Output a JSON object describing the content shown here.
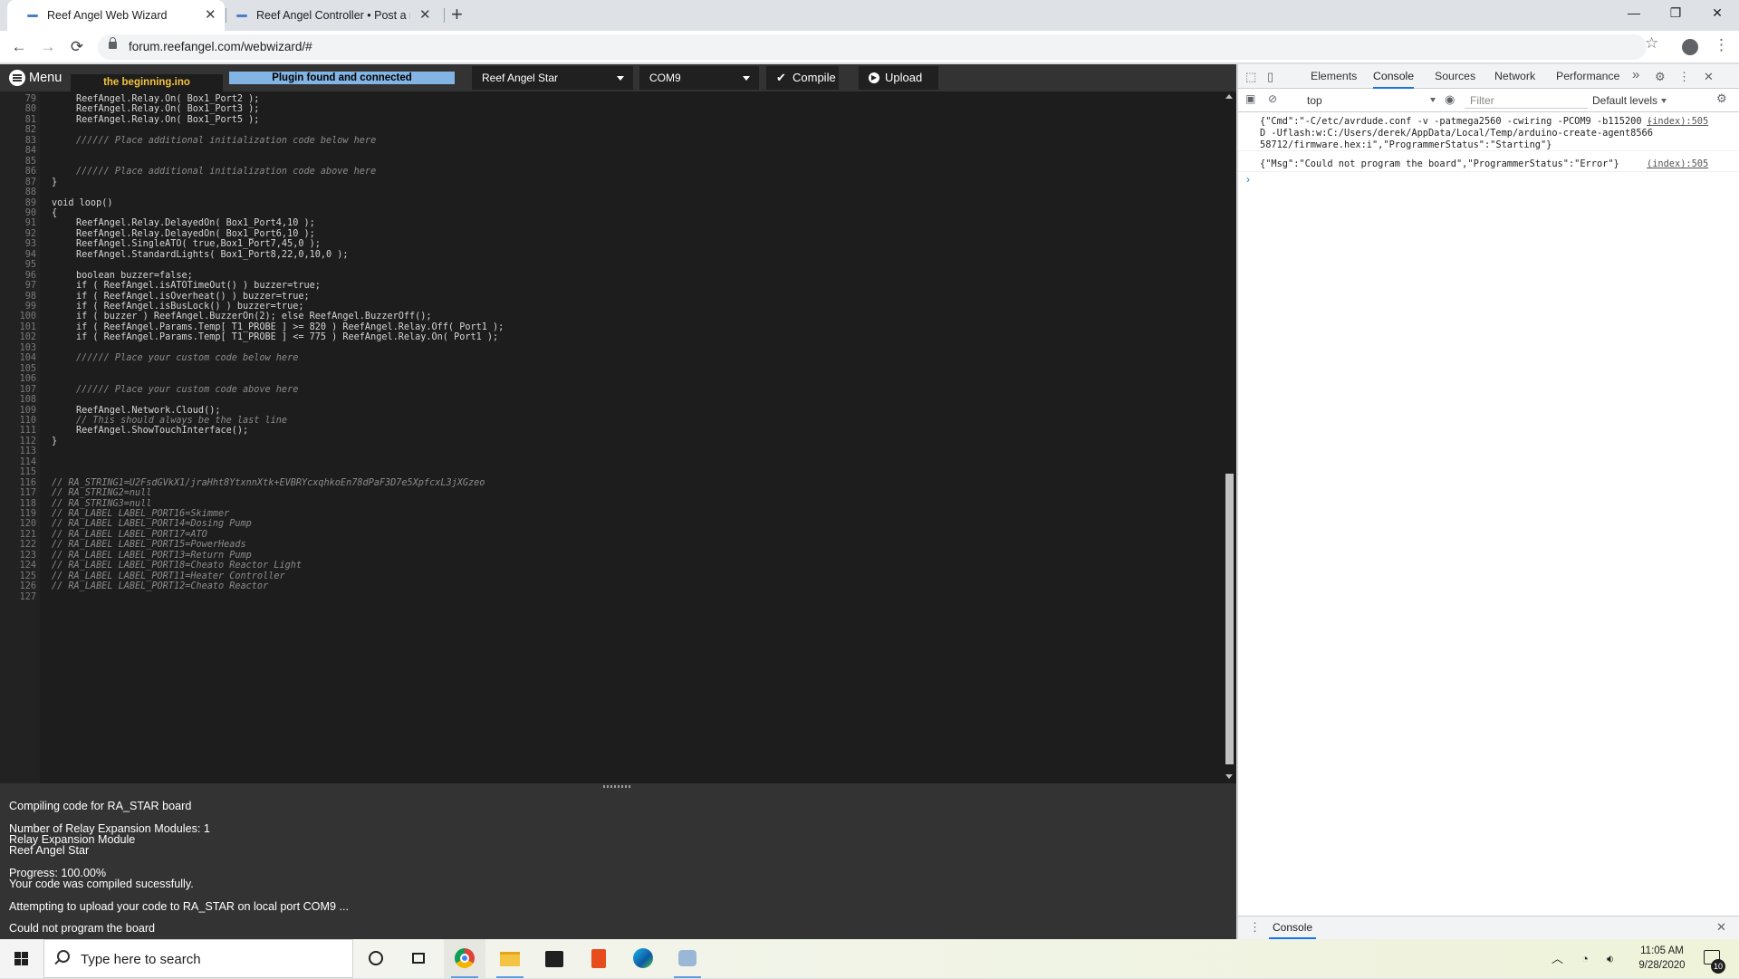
{
  "browser": {
    "tabs": [
      {
        "title": "Reef Angel Web Wizard",
        "active": true
      },
      {
        "title": "Reef Angel Controller • Post a rep",
        "active": false
      }
    ],
    "new_tab_glyph": "+",
    "close_glyph": "✕",
    "url": "forum.reefangel.com/webwizard/#",
    "window_controls": {
      "minimize": "—",
      "maximize": "❐",
      "close": "✕"
    },
    "nav": {
      "back": "←",
      "forward": "→",
      "reload": "⟳"
    },
    "icons": {
      "bookmark": "star-icon",
      "profile": "account-circle-icon",
      "menu": "kebab-menu-icon"
    }
  },
  "wizard": {
    "menu_label": "Menu",
    "file_tab": "the beginning.ino",
    "status": "Plugin found and connected",
    "board_select": "Reef Angel Star",
    "port_select": "COM9",
    "compile_label": "Compile",
    "upload_label": "Upload",
    "code_lines": [
      {
        "n": "79",
        "t": "ReefAngel.Relay.On( Box1_Port2 );",
        "c": false
      },
      {
        "n": "80",
        "t": "ReefAngel.Relay.On( Box1_Port3 );",
        "c": false
      },
      {
        "n": "81",
        "t": "ReefAngel.Relay.On( Box1_Port5 );",
        "c": false
      },
      {
        "n": "82",
        "t": "",
        "c": false
      },
      {
        "n": "83",
        "t": "////// Place additional initialization code below here",
        "c": true
      },
      {
        "n": "84",
        "t": "",
        "c": false
      },
      {
        "n": "85",
        "t": "",
        "c": false
      },
      {
        "n": "86",
        "t": "////// Place additional initialization code above here",
        "c": true
      },
      {
        "n": "87",
        "t": "}",
        "c": false
      },
      {
        "n": "88",
        "t": "",
        "c": false
      },
      {
        "n": "89",
        "t": "void loop()",
        "c": false
      },
      {
        "n": "90",
        "t": "{",
        "c": false
      },
      {
        "n": "91",
        "t": "ReefAngel.Relay.DelayedOn( Box1_Port4,10 );",
        "c": false
      },
      {
        "n": "92",
        "t": "ReefAngel.Relay.DelayedOn( Box1_Port6,10 );",
        "c": false
      },
      {
        "n": "93",
        "t": "ReefAngel.SingleATO( true,Box1_Port7,45,0 );",
        "c": false
      },
      {
        "n": "94",
        "t": "ReefAngel.StandardLights( Box1_Port8,22,0,10,0 );",
        "c": false
      },
      {
        "n": "95",
        "t": "",
        "c": false
      },
      {
        "n": "96",
        "t": "boolean buzzer=false;",
        "c": false
      },
      {
        "n": "97",
        "t": "if ( ReefAngel.isATOTimeOut() ) buzzer=true;",
        "c": false
      },
      {
        "n": "98",
        "t": "if ( ReefAngel.isOverheat() ) buzzer=true;",
        "c": false
      },
      {
        "n": "99",
        "t": "if ( ReefAngel.isBusLock() ) buzzer=true;",
        "c": false
      },
      {
        "n": "100",
        "t": "if ( buzzer ) ReefAngel.BuzzerOn(2); else ReefAngel.BuzzerOff();",
        "c": false
      },
      {
        "n": "101",
        "t": "if ( ReefAngel.Params.Temp[ T1_PROBE ] >= 820 ) ReefAngel.Relay.Off( Port1 );",
        "c": false
      },
      {
        "n": "102",
        "t": "if ( ReefAngel.Params.Temp[ T1_PROBE ] <= 775 ) ReefAngel.Relay.On( Port1 );",
        "c": false
      },
      {
        "n": "103",
        "t": "",
        "c": false
      },
      {
        "n": "104",
        "t": "////// Place your custom code below here",
        "c": true
      },
      {
        "n": "105",
        "t": "",
        "c": false
      },
      {
        "n": "106",
        "t": "",
        "c": false
      },
      {
        "n": "107",
        "t": "////// Place your custom code above here",
        "c": true
      },
      {
        "n": "108",
        "t": "",
        "c": false
      },
      {
        "n": "109",
        "t": "ReefAngel.Network.Cloud();",
        "c": false
      },
      {
        "n": "110",
        "t": "// This should always be the last line",
        "c": true
      },
      {
        "n": "111",
        "t": "ReefAngel.ShowTouchInterface();",
        "c": false
      },
      {
        "n": "112",
        "t": "}",
        "c": false
      },
      {
        "n": "113",
        "t": "",
        "c": false
      },
      {
        "n": "114",
        "t": "",
        "c": false
      },
      {
        "n": "115",
        "t": "",
        "c": false
      },
      {
        "n": "116",
        "t": "// RA_STRING1=U2FsdGVkX1/jraHht8YtxnnXtk+EVBRYcxqhkoEn78dPaF3D7e5XpfcxL3jXGzeo",
        "c": true
      },
      {
        "n": "117",
        "t": "// RA_STRING2=null",
        "c": true
      },
      {
        "n": "118",
        "t": "// RA_STRING3=null",
        "c": true
      },
      {
        "n": "119",
        "t": "// RA_LABEL LABEL_PORT16=Skimmer",
        "c": true
      },
      {
        "n": "120",
        "t": "// RA_LABEL LABEL_PORT14=Dosing Pump",
        "c": true
      },
      {
        "n": "121",
        "t": "// RA_LABEL LABEL_PORT17=ATO",
        "c": true
      },
      {
        "n": "122",
        "t": "// RA_LABEL LABEL_PORT15=PowerHeads",
        "c": true
      },
      {
        "n": "123",
        "t": "// RA_LABEL LABEL_PORT13=Return Pump",
        "c": true
      },
      {
        "n": "124",
        "t": "// RA_LABEL LABEL_PORT18=Cheato Reactor Light",
        "c": true
      },
      {
        "n": "125",
        "t": "// RA_LABEL LABEL_PORT11=Heater Controller",
        "c": true
      },
      {
        "n": "126",
        "t": "// RA_LABEL LABEL_PORT12=Cheato Reactor",
        "c": true
      },
      {
        "n": "127",
        "t": "",
        "c": false
      }
    ],
    "output_lines": [
      "Compiling code for RA_STAR board",
      "",
      "Number of Relay Expansion Modules: 1",
      "Relay Expansion Module",
      "Reef Angel Star",
      "",
      "Progress: 100.00%",
      "Your code was compiled sucessfully.",
      "",
      "Attempting to upload your code to RA_STAR on local port COM9 ...",
      "",
      "Could not program the board"
    ]
  },
  "devtools": {
    "tabs": [
      "Elements",
      "Console",
      "Sources",
      "Network",
      "Performance"
    ],
    "active_tab": "Console",
    "overflow_glyph": "»",
    "context": "top",
    "filter_placeholder": "Filter",
    "levels": "Default levels",
    "messages": [
      {
        "text": "{\"Cmd\":\"-C/etc/avrdude.conf -v -patmega2560 -cwiring -PCOM9 -b115200 -D -Uflash:w:C:/Users/derek/AppData/Local/Temp/arduino-create-agent856658712/firmware.hex:i\",\"ProgrammerStatus\":\"Starting\"}",
        "source": "(index):505"
      },
      {
        "text": "{\"Msg\":\"Could not program the board\",\"ProgrammerStatus\":\"Error\"}",
        "source": "(index):505"
      }
    ],
    "prompt": "›",
    "drawer_tab": "Console"
  },
  "taskbar": {
    "search_placeholder": "Type here to search",
    "apps": [
      "cortana-icon",
      "task-view-icon",
      "chrome-icon",
      "file-explorer-icon",
      "store-icon",
      "office-icon",
      "edge-icon",
      "arduino-icon"
    ],
    "time": "11:05 AM",
    "date": "9/28/2020",
    "notifications": "10"
  },
  "colors": {
    "editor_bg": "#1d1d1d",
    "toolbar_bg": "#333333",
    "filename": "#f3c23d",
    "status_bg": "#82b4e4",
    "accent": "#1a73e8"
  }
}
